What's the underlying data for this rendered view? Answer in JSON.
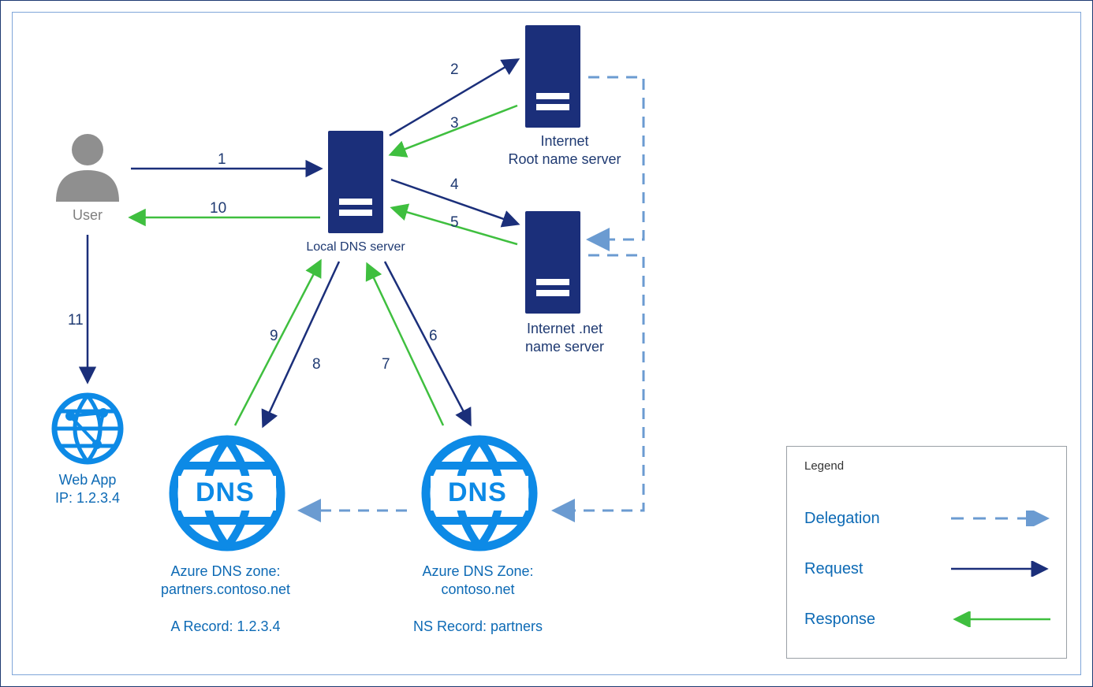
{
  "nodes": {
    "user": "User",
    "local_dns": "Local DNS server",
    "root_server_l1": "Internet",
    "root_server_l2": "Root name server",
    "net_server_l1": "Internet .net",
    "net_server_l2": "name server",
    "webapp_l1": "Web App",
    "webapp_l2": "IP: 1.2.3.4",
    "zone_partners_l1": "Azure DNS zone:",
    "zone_partners_l2": "partners.contoso.net",
    "zone_partners_rec": "A Record: 1.2.3.4",
    "zone_contoso_l1": "Azure DNS Zone:",
    "zone_contoso_l2": "contoso.net",
    "zone_contoso_rec": "NS Record: partners",
    "dns_icon_text": "DNS"
  },
  "steps": {
    "s1": "1",
    "s2": "2",
    "s3": "3",
    "s4": "4",
    "s5": "5",
    "s6": "6",
    "s7": "7",
    "s8": "8",
    "s9": "9",
    "s10": "10",
    "s11": "11"
  },
  "legend": {
    "title": "Legend",
    "delegation": "Delegation",
    "request": "Request",
    "response": "Response"
  },
  "colors": {
    "request": "#1b2f7a",
    "response": "#3fbf3f",
    "delegation": "#6b9bd1",
    "azure_blue": "#0d8ae6"
  }
}
